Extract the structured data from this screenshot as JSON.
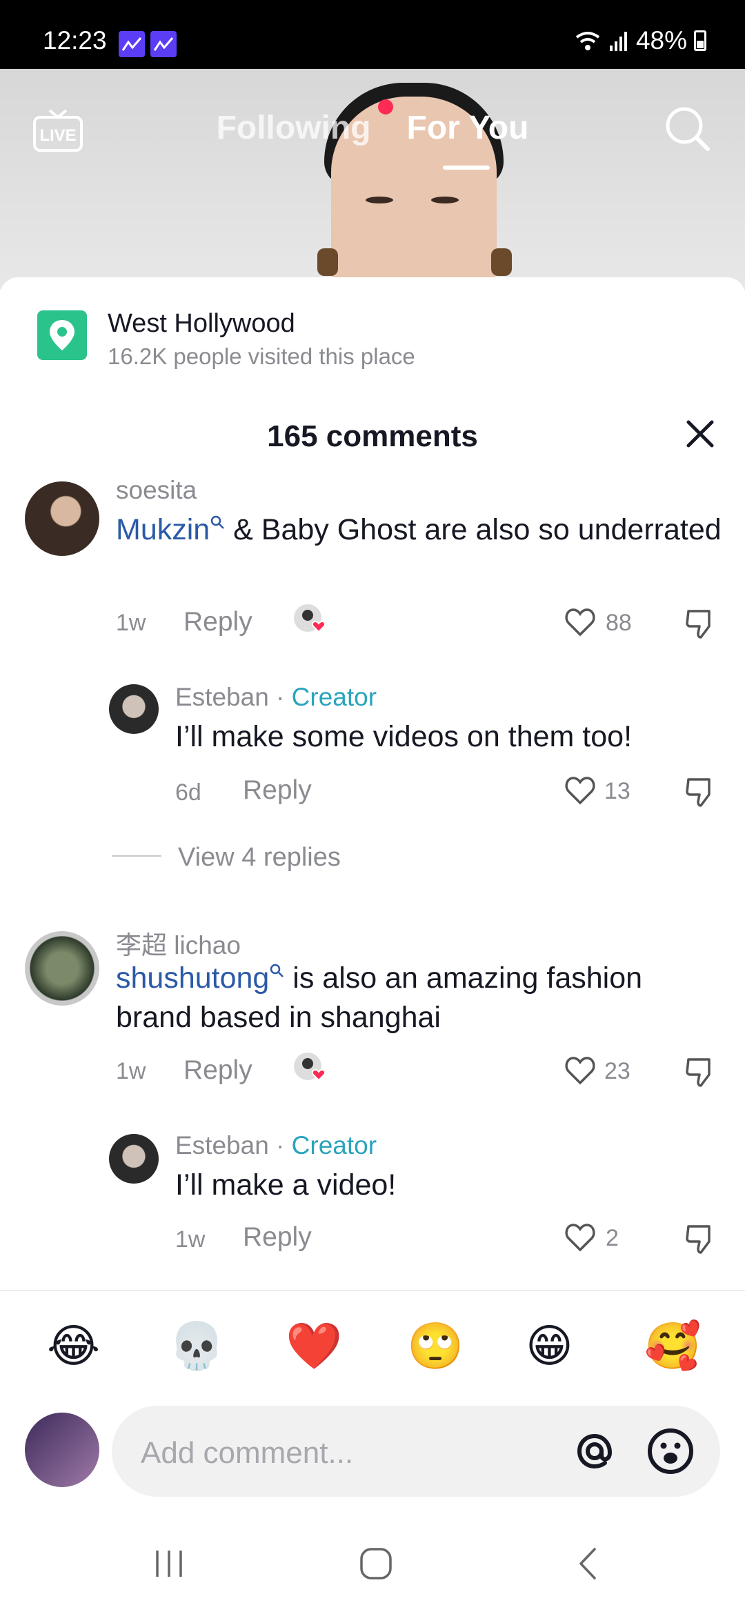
{
  "status_bar": {
    "time": "12:23",
    "battery": "48%"
  },
  "top_nav": {
    "live_label": "LIVE",
    "following": "Following",
    "for_you": "For You"
  },
  "place": {
    "name": "West Hollywood",
    "visits": "16.2K people visited this place"
  },
  "comments_header": {
    "title": "165 comments"
  },
  "comments": [
    {
      "username": "soesita",
      "mention": "Mukzin",
      "text": " & Baby Ghost are also so underrated",
      "time": "1w",
      "reply_label": "Reply",
      "likes": "88"
    },
    {
      "username": "Esteban",
      "separator": " · ",
      "tag": "Creator",
      "text": "I’ll make some videos on them too!",
      "time": "6d",
      "reply_label": "Reply",
      "likes": "13"
    },
    {
      "username": "李超 lichao",
      "mention": "shushutong",
      "text": " is also an amazing fashion brand based in shanghai",
      "time": "1w",
      "reply_label": "Reply",
      "likes": "23"
    },
    {
      "username": "Esteban",
      "separator": " · ",
      "tag": "Creator",
      "text": "I’ll make a video!",
      "time": "1w",
      "reply_label": "Reply",
      "likes": "2"
    }
  ],
  "view_replies": "View 4 replies",
  "emojis": [
    "😂",
    "💀",
    "❤️",
    "🙄",
    "😁",
    "🥰"
  ],
  "composer": {
    "placeholder": "Add comment..."
  },
  "colors": {
    "accent_red": "#fe2c55",
    "mention_blue": "#2b5aa6",
    "creator_teal": "#2aa4bd",
    "place_green": "#2bc38c"
  }
}
